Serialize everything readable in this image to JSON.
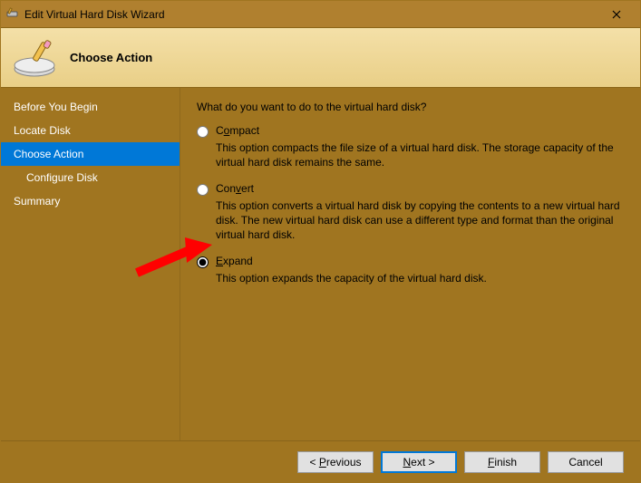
{
  "window": {
    "title": "Edit Virtual Hard Disk Wizard"
  },
  "banner": {
    "heading": "Choose Action"
  },
  "sidebar": {
    "steps": [
      {
        "label": "Before You Begin"
      },
      {
        "label": "Locate Disk"
      },
      {
        "label": "Choose Action"
      },
      {
        "label": "Configure Disk"
      },
      {
        "label": "Summary"
      }
    ]
  },
  "main": {
    "prompt": "What do you want to do to the virtual hard disk?",
    "options": [
      {
        "key": "compact",
        "name_pre": "C",
        "name_mn": "o",
        "name_post": "mpact",
        "desc": "This option compacts the file size of a virtual hard disk. The storage capacity of the virtual hard disk remains the same.",
        "selected": false
      },
      {
        "key": "convert",
        "name_pre": "Con",
        "name_mn": "v",
        "name_post": "ert",
        "desc": "This option converts a virtual hard disk by copying the contents to a new virtual hard disk. The new virtual hard disk can use a different type and format than the original virtual hard disk.",
        "selected": false
      },
      {
        "key": "expand",
        "name_pre": "",
        "name_mn": "E",
        "name_post": "xpand",
        "desc": "This option expands the capacity of the virtual hard disk.",
        "selected": true
      }
    ]
  },
  "footer": {
    "previous_pre": "< ",
    "previous_mn": "P",
    "previous_post": "revious",
    "next_pre": "",
    "next_mn": "N",
    "next_post": "ext >",
    "finish_pre": "",
    "finish_mn": "F",
    "finish_post": "inish",
    "cancel": "Cancel"
  }
}
